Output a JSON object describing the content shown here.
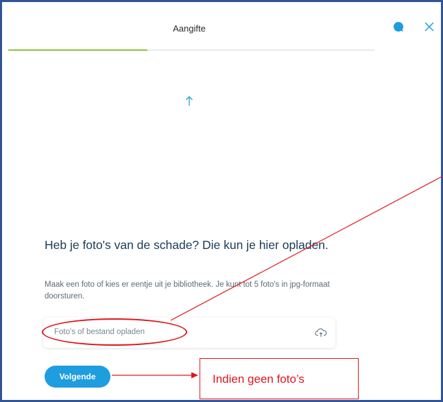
{
  "header": {
    "title": "Aangifte",
    "progress_fraction": 0.38
  },
  "icons": {
    "chat": "chat-bubble-icon",
    "close": "close-icon",
    "arrow": "arrow-up-icon",
    "upload": "cloud-upload-icon"
  },
  "main": {
    "question": "Heb je foto's van de schade? Die kun je hier opladen.",
    "description": "Maak een foto of kies er eentje uit je bibliotheek. Je kunt tot 5 foto's in jpg-formaat doorsturen.",
    "upload_label": "Foto's of bestand opladen",
    "next_label": "Volgende"
  },
  "annotation": {
    "note": "Indien geen foto’s"
  },
  "colors": {
    "accent": "#1e9ddf",
    "progress": "#8ec341",
    "annotation": "#e0141b",
    "frame": "#2f5597"
  }
}
